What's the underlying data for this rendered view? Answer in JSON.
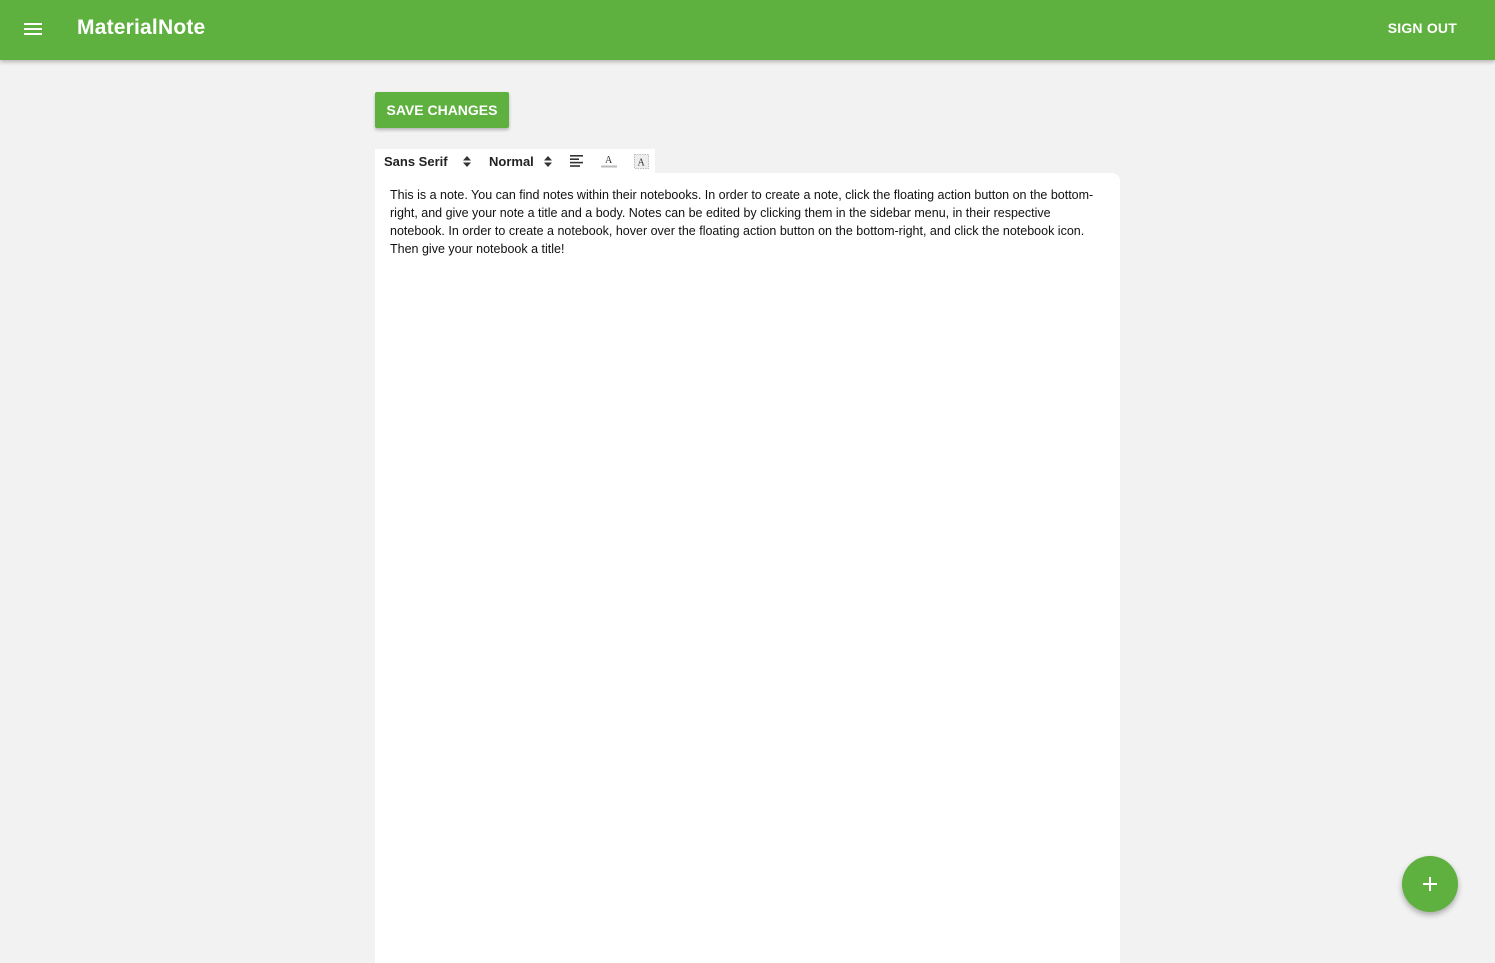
{
  "app_bar": {
    "title": "MaterialNote",
    "sign_out_label": "SIGN OUT",
    "menu_icon": "hamburger-menu-icon",
    "color": "#5eb03f"
  },
  "actions": {
    "save_label": "SAVE CHANGES"
  },
  "toolbar": {
    "font_picker": "Sans Serif",
    "size_picker": "Normal",
    "icons": [
      "align-left-icon",
      "text-color-icon",
      "background-color-icon"
    ]
  },
  "editor": {
    "body": "This is a note. You can find notes within their notebooks. In order to create a note, click the floating action button on the bottom-right, and give your note a title and a body. Notes can be edited by clicking them in the sidebar menu, in their respective notebook. In order to create a notebook, hover over the floating action button on the bottom-right, and click the notebook icon. Then give your notebook a title!"
  },
  "fab": {
    "icon": "plus-icon"
  }
}
